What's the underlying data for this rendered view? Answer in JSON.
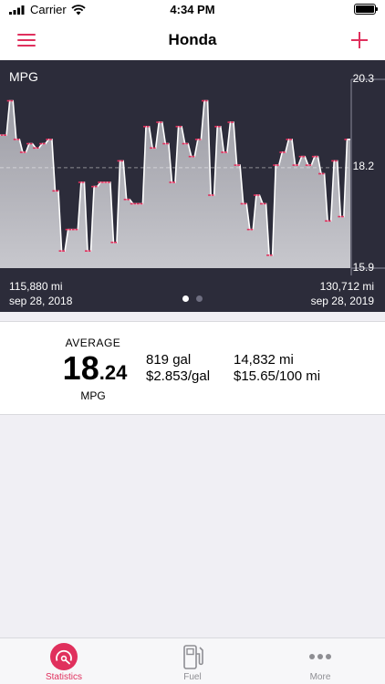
{
  "status": {
    "carrier": "Carrier",
    "time": "4:34 PM"
  },
  "nav": {
    "title": "Honda"
  },
  "chart": {
    "title": "MPG",
    "y_max_label": "20.3",
    "y_mid_label": "18.2",
    "y_min_label": "15.9",
    "start_odometer": "115,880 mi",
    "start_date": "sep 28, 2018",
    "end_odometer": "130,712 mi",
    "end_date": "sep 28, 2019",
    "page_index": 1,
    "page_count": 2
  },
  "chart_data": {
    "type": "area",
    "title": "MPG",
    "ylim": [
      15.9,
      20.3
    ],
    "average": 18.24,
    "x_range": [
      "115,880 mi",
      "130,712 mi"
    ],
    "values": [
      19.0,
      19.0,
      19.0,
      19.8,
      19.8,
      18.9,
      18.9,
      18.6,
      18.6,
      18.8,
      18.8,
      18.7,
      18.7,
      18.8,
      18.8,
      18.9,
      18.9,
      17.7,
      17.7,
      16.3,
      16.3,
      16.8,
      16.8,
      16.8,
      16.8,
      17.9,
      17.9,
      16.3,
      16.3,
      17.8,
      17.8,
      17.9,
      17.9,
      17.9,
      17.9,
      16.5,
      16.5,
      18.4,
      18.4,
      17.5,
      17.5,
      17.4,
      17.4,
      17.4,
      17.4,
      19.2,
      19.2,
      18.7,
      18.7,
      19.3,
      19.3,
      18.8,
      18.8,
      17.9,
      17.9,
      19.2,
      19.2,
      18.8,
      18.8,
      18.5,
      18.5,
      18.9,
      18.9,
      19.8,
      19.8,
      17.6,
      17.6,
      19.2,
      19.2,
      18.6,
      18.6,
      19.3,
      19.3,
      18.3,
      18.3,
      17.4,
      17.4,
      16.8,
      16.8,
      17.6,
      17.6,
      17.4,
      17.4,
      16.2,
      16.2,
      18.3,
      18.3,
      18.6,
      18.6,
      18.9,
      18.9,
      18.3,
      18.3,
      18.5,
      18.5,
      18.3,
      18.3,
      18.5,
      18.5,
      18.1,
      18.1,
      17.0,
      17.0,
      18.4,
      18.4,
      17.1,
      17.1,
      18.9,
      18.9
    ],
    "average_line": true,
    "grid": false
  },
  "summary": {
    "average_label": "AVERAGE",
    "average_whole": "18",
    "average_decimal": ".24",
    "average_unit": "MPG",
    "gallons": "819 gal",
    "price_per_gal": "$2.853/gal",
    "distance": "14,832 mi",
    "cost_per_distance": "$15.65/100 mi"
  },
  "tabs": [
    {
      "label": "Statistics",
      "icon": "gauge-icon",
      "active": true
    },
    {
      "label": "Fuel",
      "icon": "fuel-pump-icon",
      "active": false
    },
    {
      "label": "More",
      "icon": "ellipsis-icon",
      "active": false
    }
  ],
  "colors": {
    "accent": "#e0305d",
    "chart_bg": "#2c2c3a",
    "tab_inactive": "#8e8e93"
  }
}
